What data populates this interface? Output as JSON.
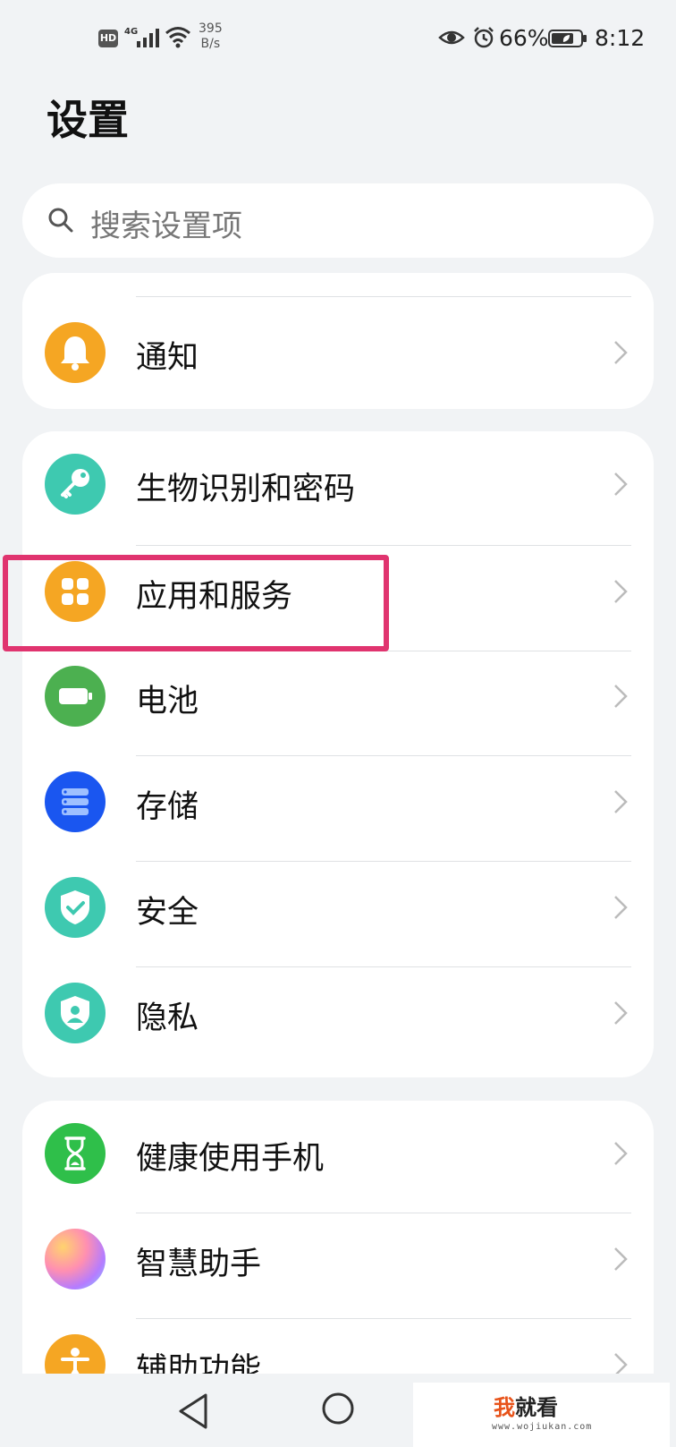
{
  "status_bar": {
    "hd": "HD",
    "network": "4G",
    "speed_value": "395",
    "speed_unit": "B/s",
    "battery_percent": "66%",
    "time": "8:12"
  },
  "page": {
    "title": "设置"
  },
  "search": {
    "placeholder": "搜索设置项"
  },
  "groups": [
    {
      "items": [
        {
          "label": "通知",
          "icon": "bell-icon",
          "color": "#f5a623"
        }
      ]
    },
    {
      "items": [
        {
          "label": "生物识别和密码",
          "icon": "key-icon",
          "color": "#3ec9b0"
        },
        {
          "label": "应用和服务",
          "icon": "apps-grid-icon",
          "color": "#f5a623",
          "highlighted": true
        },
        {
          "label": "电池",
          "icon": "battery-icon",
          "color": "#4cb050"
        },
        {
          "label": "存储",
          "icon": "storage-icon",
          "color": "#1a56f0"
        },
        {
          "label": "安全",
          "icon": "shield-check-icon",
          "color": "#3ec9b0"
        },
        {
          "label": "隐私",
          "icon": "privacy-shield-icon",
          "color": "#3ec9b0"
        }
      ]
    },
    {
      "items": [
        {
          "label": "健康使用手机",
          "icon": "hourglass-icon",
          "color": "#2fbf4a"
        },
        {
          "label": "智慧助手",
          "icon": "assistant-orb-icon",
          "color": "#c77dff"
        },
        {
          "label": "辅助功能",
          "icon": "accessibility-icon",
          "color": "#f5a623"
        }
      ]
    }
  ],
  "highlight_color": "#e0346f",
  "watermark": {
    "text_accent": "我",
    "text": "就看",
    "url": "www.wojiukan.com"
  }
}
